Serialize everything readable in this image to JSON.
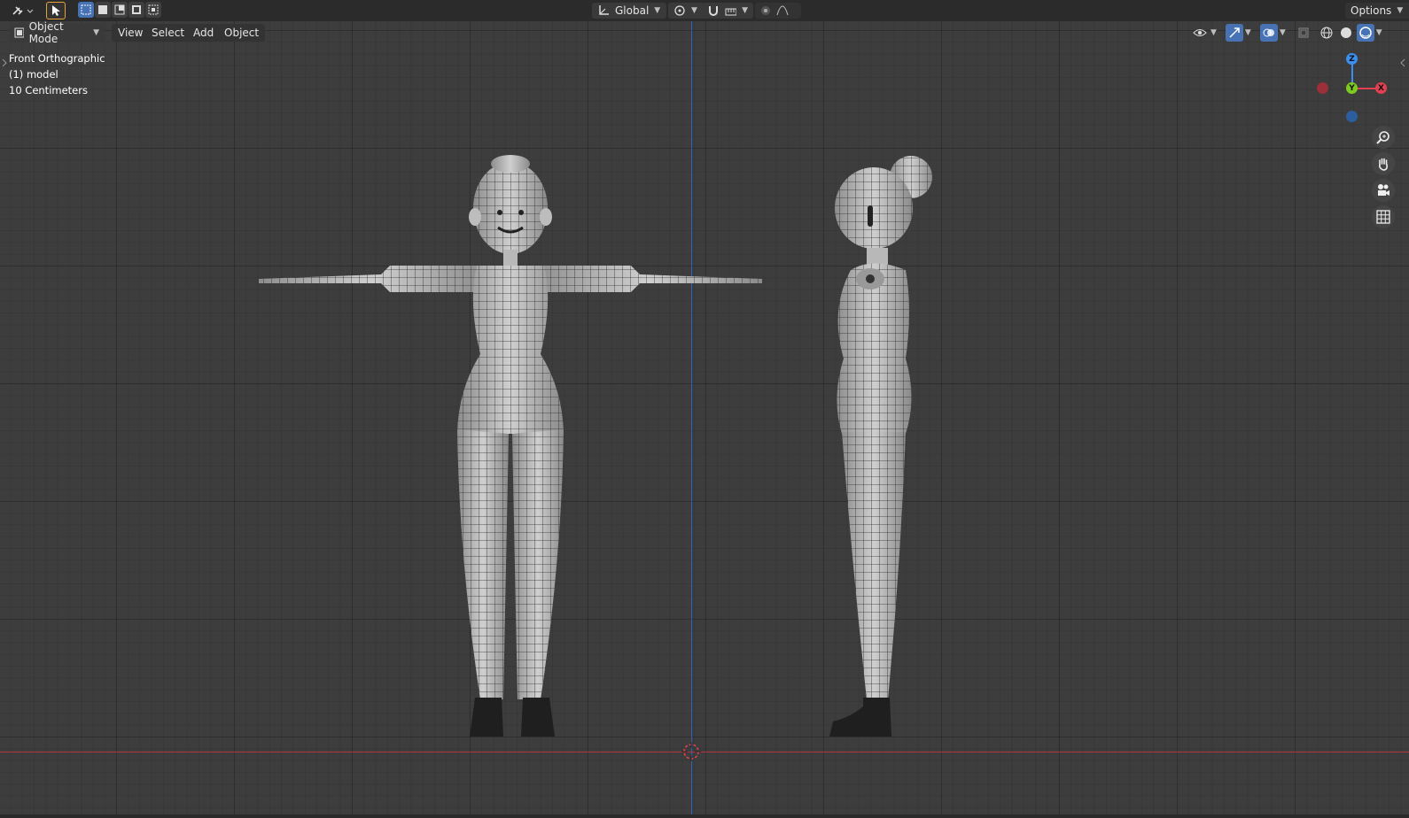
{
  "topbar": {
    "transform_orientation": "Global",
    "options_label": "Options"
  },
  "header": {
    "mode_label": "Object Mode",
    "menus": [
      "View",
      "Select",
      "Add",
      "Object"
    ]
  },
  "viewport": {
    "view_name": "Front Orthographic",
    "object_label": "(1) model",
    "scale_label": "10 Centimeters"
  },
  "gizmo": {
    "z_label": "Z",
    "y_label": "Y",
    "x_label": "X",
    "colors": {
      "x": "#e0404f",
      "y": "#7ecb20",
      "z": "#3b8ff0"
    }
  },
  "icons": {
    "editor_type": "editor-type-icon",
    "select_tool": "select-cursor-icon",
    "box_modes": [
      "select-new-icon",
      "select-extend-icon",
      "select-subtract-icon",
      "select-invert-icon",
      "select-intersect-icon"
    ],
    "nav": [
      "zoom-icon",
      "pan-hand-icon",
      "camera-icon",
      "grid-view-icon"
    ]
  }
}
